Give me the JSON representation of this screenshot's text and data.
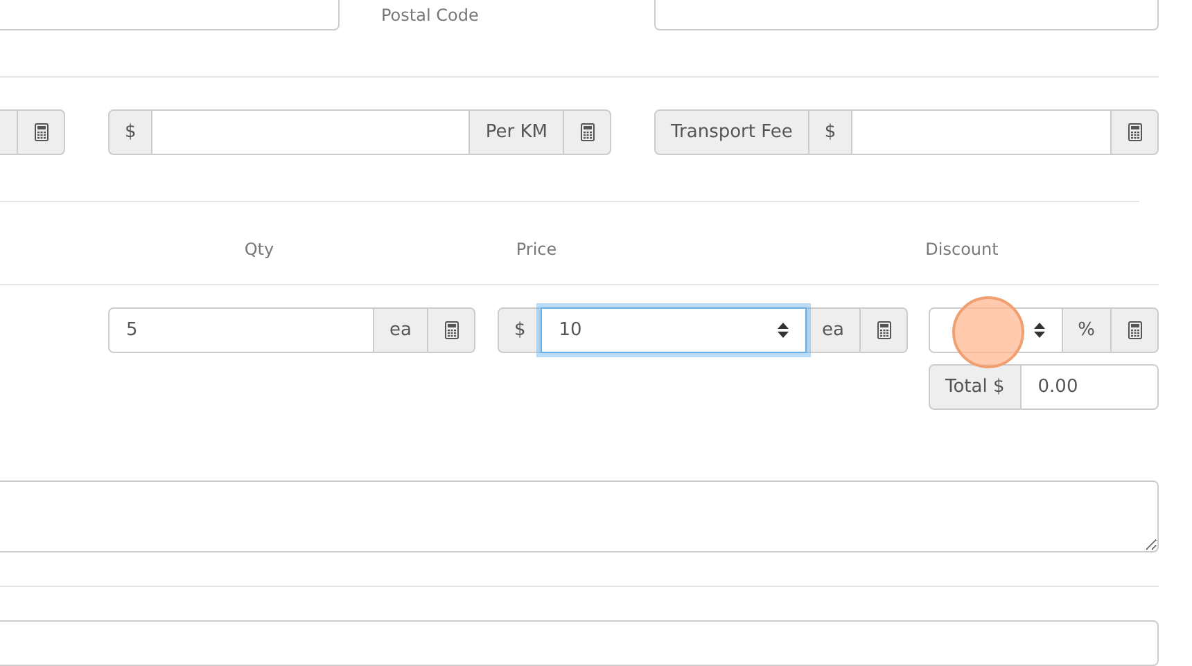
{
  "address_row": {
    "label": "Postal Code"
  },
  "transport": {
    "per_km": {
      "prefix": "$",
      "suffix": "Per KM"
    },
    "transport_fee": {
      "label": "Transport Fee",
      "prefix": "$"
    }
  },
  "columns": [
    "Qty",
    "Price",
    "Discount"
  ],
  "line_item": {
    "qty": {
      "value": "5",
      "unit": "ea"
    },
    "price": {
      "prefix": "$",
      "value": "10",
      "unit": "ea",
      "focused": true
    },
    "discount": {
      "unit": "%"
    },
    "total": {
      "label": "Total $",
      "value": "0.00"
    }
  }
}
